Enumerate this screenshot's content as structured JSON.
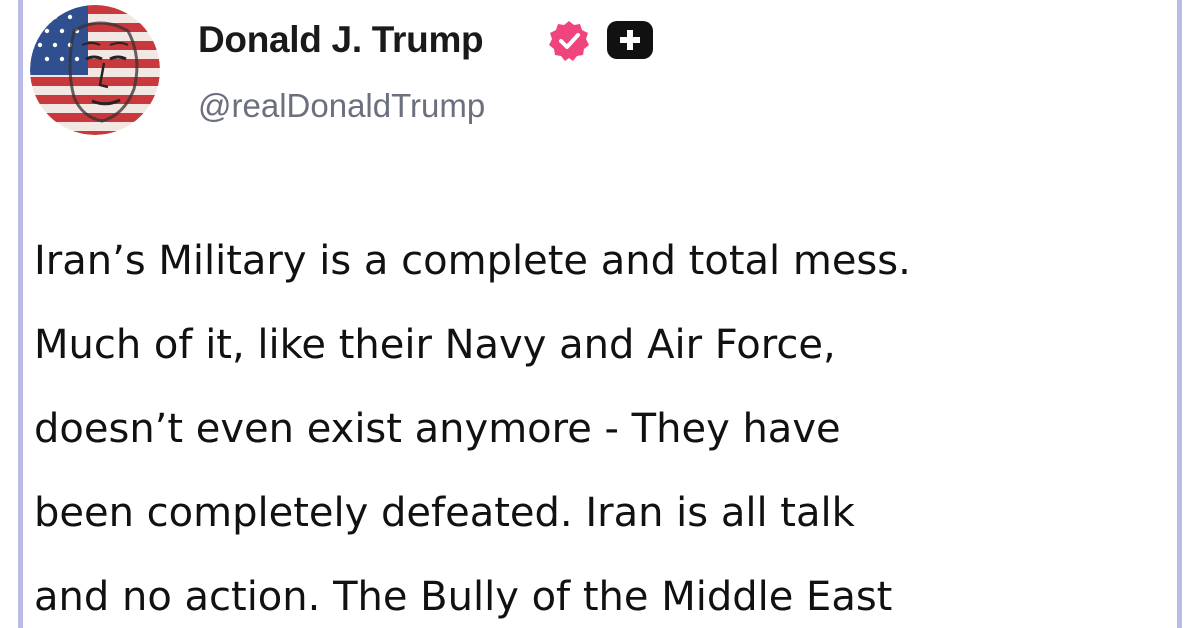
{
  "post": {
    "author": {
      "display_name": "Donald J. Trump",
      "handle": "@realDonaldTrump",
      "verified_badge_icon": "verified-badge-icon",
      "plus_badge_icon": "plus-badge-icon",
      "avatar": "avatar"
    },
    "body_lines": [
      "Iran’s Military is a complete and total mess.",
      "Much of it, like their Navy and Air Force,",
      "doesn’t even exist anymore - They have",
      "been completely defeated. Iran is all talk",
      "and no action. The Bully of the Middle East"
    ]
  },
  "colors": {
    "verified_badge": "#f0457c",
    "plus_badge": "#111111",
    "frame_border": "#b9bde6",
    "handle_text": "#6b6f7e"
  }
}
